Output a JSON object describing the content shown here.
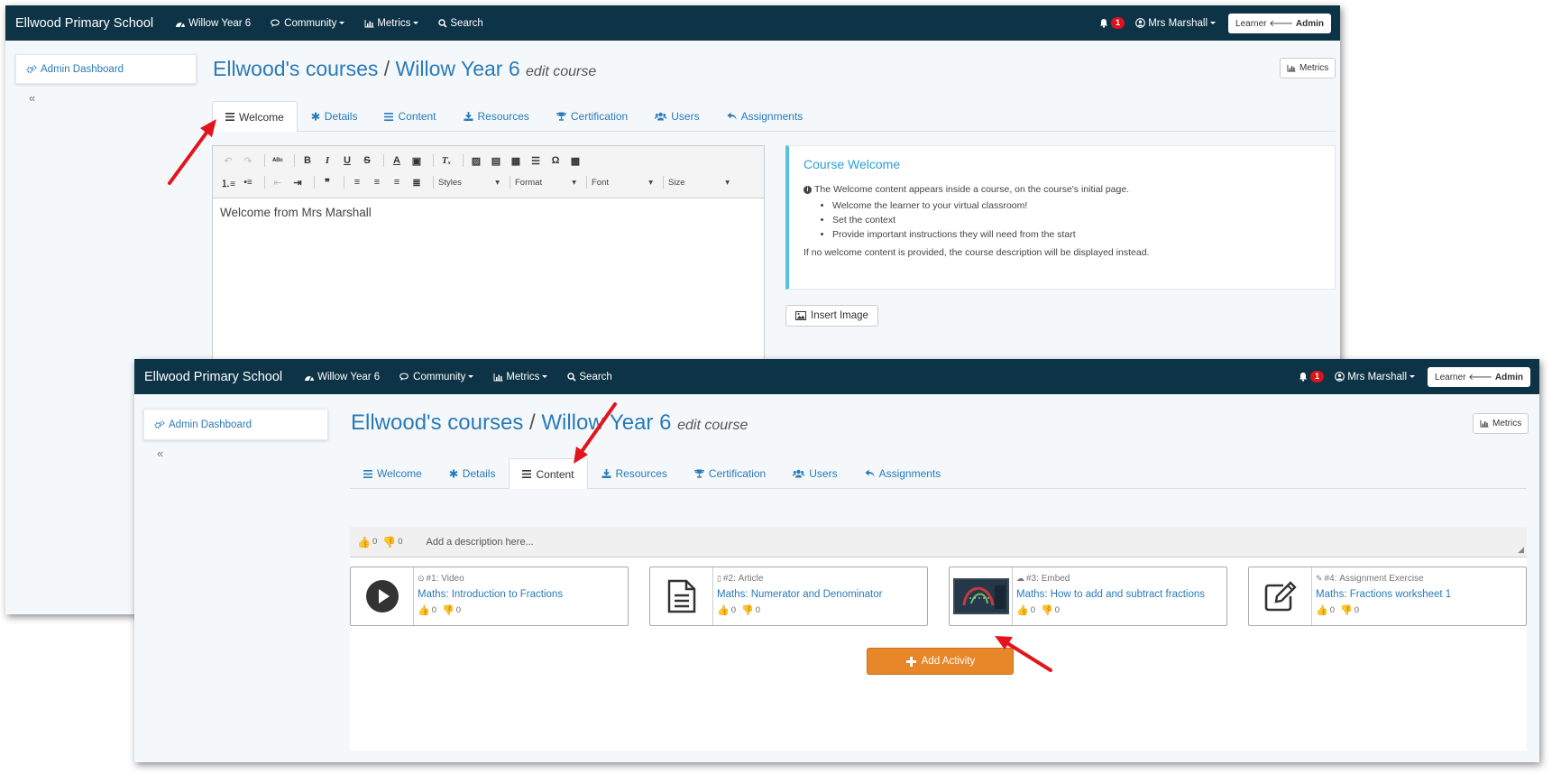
{
  "nav": {
    "brand": "Ellwood Primary School",
    "course": "Willow Year 6",
    "community": "Community",
    "metrics": "Metrics",
    "search": "Search",
    "notif_count": "1",
    "user": "Mrs Marshall",
    "learner_label": "Learner",
    "admin_label": "Admin"
  },
  "sidebar": {
    "dashboard": "Admin Dashboard",
    "collapse": "«"
  },
  "page": {
    "courses": "Ellwood's courses",
    "sep": "/",
    "course": "Willow Year 6",
    "edit": "edit course",
    "metrics_button": "Metrics"
  },
  "tabs": [
    "Welcome",
    "Details",
    "Content",
    "Resources",
    "Certification",
    "Users",
    "Assignments"
  ],
  "editor": {
    "styles": "Styles",
    "format": "Format",
    "font": "Font",
    "size": "Size",
    "text": "Welcome from Mrs Marshall"
  },
  "info": {
    "title": "Course Welcome",
    "intro": "The Welcome content appears inside a course, on the course's initial page.",
    "bullets": [
      "Welcome the learner to your virtual classroom!",
      "Set the context",
      "Provide important instructions they will need from the start"
    ],
    "footer": "If no welcome content is provided, the course description will be displayed instead."
  },
  "insert_image": "Insert Image",
  "content": {
    "description_placeholder": "Add a description here...",
    "up": "0",
    "down": "0",
    "activities": [
      {
        "number": "#1",
        "type": "Video",
        "title": "Maths: Introduction to Fractions",
        "up": "0",
        "down": "0"
      },
      {
        "number": "#2",
        "type": "Article",
        "title": "Maths: Numerator and Denominator",
        "up": "0",
        "down": "0"
      },
      {
        "number": "#3",
        "type": "Embed",
        "title": "Maths: How to add and subtract fractions",
        "up": "0",
        "down": "0"
      },
      {
        "number": "#4",
        "type": "Assignment Exercise",
        "title": "Maths: Fractions worksheet 1",
        "up": "0",
        "down": "0"
      }
    ],
    "add_activity": "Add Activity"
  },
  "colors": {
    "navbar": "#0d3346",
    "link": "#2a7ab8",
    "accent": "#e8872a",
    "annotation_arrow": "#e3141c"
  }
}
